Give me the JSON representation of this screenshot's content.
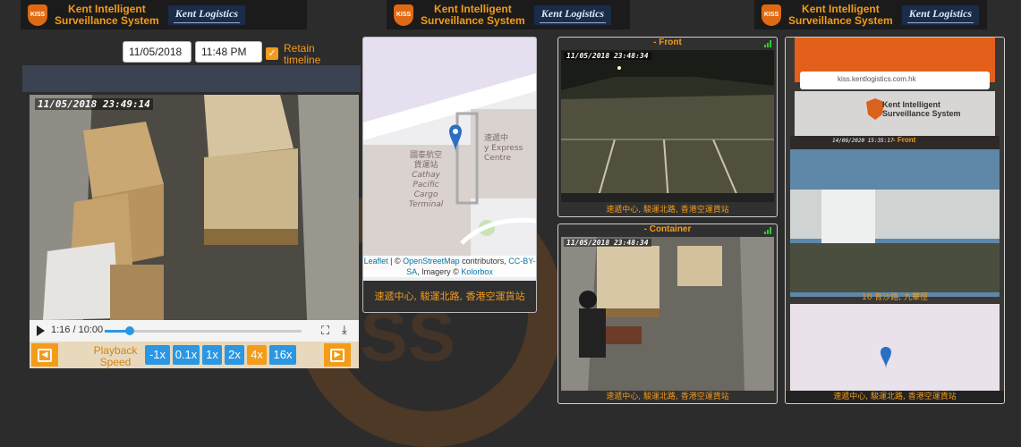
{
  "header": {
    "logo_text": "KISS",
    "title_line1": "Kent Intelligent",
    "title_line2": "Surveillance System",
    "partner": "Kent Logistics"
  },
  "playback": {
    "date": "11/05/2018",
    "time": "11:48 PM",
    "retain_label_1": "Retain",
    "retain_label_2": "timeline",
    "retain_checked": true,
    "video_timestamp": "11/05/2018 23:49:14",
    "time_display": "1:16 / 10:00",
    "progress_fraction": 0.127,
    "speed_label_1": "Playback",
    "speed_label_2": "Speed",
    "speeds": [
      "-1x",
      "0.1x",
      "1x",
      "2x",
      "4x",
      "16x"
    ],
    "active_speed": "4x"
  },
  "map": {
    "label_terminal_cn1": "國泰航空",
    "label_terminal_cn2": "貨運站",
    "label_terminal_en1": "Cathay",
    "label_terminal_en2": "Pacific",
    "label_terminal_en3": "Cargo Terminal",
    "label_express_cn": "速遞中",
    "label_express_en1": "y Express",
    "label_express_en2": "Centre",
    "attribution_leaflet": "Leaflet",
    "attribution_mid": " | © ",
    "attribution_osm": "OpenStreetMap",
    "attribution_rest": " contributors, ",
    "attribution_cc": "CC-BY-",
    "attribution_sa": "SA",
    "attribution_imagery": ", Imagery © ",
    "attribution_kolor": "Kolorbox",
    "address": "速遞中心, 駿運北路, 香港空運貨站"
  },
  "cameras": [
    {
      "title": "- Front",
      "timestamp": "11/05/2018 23:48:34",
      "address": "速遞中心, 駿運北路, 香港空運貨站"
    },
    {
      "title": "- Container",
      "timestamp": "11/05/2018 23:48:34",
      "address": "速遞中心, 駿運北路, 香港空運貨站"
    },
    {
      "title": "",
      "timestamp": "",
      "address": "速遞中心, 駿運北路, 香港空運貨站"
    }
  ],
  "phone": {
    "url": "kiss.kentlogistics.com.hk",
    "title_line1": "Kent Intelligent",
    "title_line2": "Surveillance System",
    "cam_title": "- Front",
    "timestamp": "14/06/2020 15:35:17",
    "address": "10 青沙路, 九華徑"
  },
  "colors": {
    "accent": "#f49b1a",
    "button": "#2b97e3",
    "header_bg": "#1b1b1b",
    "page_bg": "#2c2c2c"
  }
}
